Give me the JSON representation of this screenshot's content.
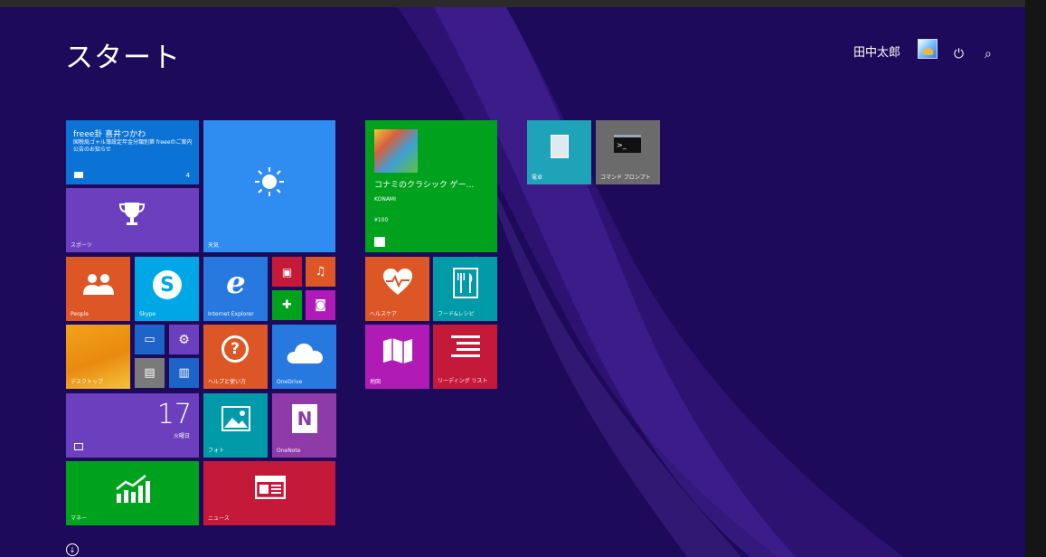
{
  "header": {
    "title": "スタート",
    "user_name": "田中太郎"
  },
  "tiles": {
    "mail": {
      "title": "freee卦 喜井つかわ",
      "body": "国税局ゴャル簿設定年金分類別第 freeeのご案内 公告のお知らせ",
      "count": "4"
    },
    "weather": {
      "label": "天気"
    },
    "sports": {
      "label": "スポーツ"
    },
    "people": {
      "label": "People"
    },
    "skype": {
      "label": "Skype"
    },
    "ie": {
      "label": "Internet Explorer"
    },
    "desktop": {
      "label": "デスクトップ"
    },
    "help": {
      "label": "ヘルプと使い方"
    },
    "onedrive": {
      "label": "OneDrive"
    },
    "calendar": {
      "date": "17",
      "day": "火曜日"
    },
    "photos": {
      "label": "フォト"
    },
    "onenote": {
      "label": "OneNote"
    },
    "finance": {
      "label": "マネー"
    },
    "news": {
      "label": "ニュース"
    },
    "store": {
      "app_name": "コナミのクラシック ゲー...",
      "publisher": "KONAMI",
      "price": "¥100"
    },
    "health": {
      "label": "ヘルスケア"
    },
    "food": {
      "label": "フード&レシピ"
    },
    "maps": {
      "label": "地図"
    },
    "reading": {
      "label": "リーディング リスト"
    },
    "notepad": {
      "label": "電卓"
    },
    "cmd": {
      "label": "コマンド プロンプト"
    }
  },
  "colors": {
    "background": "#1e0a5a",
    "blue": "#0b73d6",
    "purple": "#6b3fbd",
    "orange": "#dd5726",
    "green": "#00a21d",
    "teal": "#009aa8",
    "red": "#c5193a",
    "magenta": "#b01ab5"
  },
  "icons": [
    "mail-icon",
    "sun-icon",
    "trophy-icon",
    "people-icon",
    "skype-icon",
    "ie-icon",
    "power-icon",
    "search-icon",
    "scroll-down-icon"
  ]
}
